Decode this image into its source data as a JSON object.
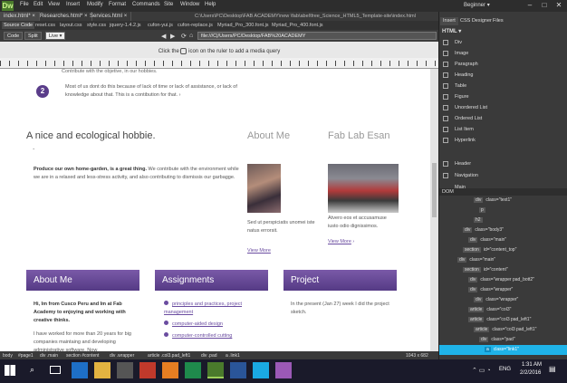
{
  "app": {
    "logo": "Dw",
    "menus": [
      "File",
      "Edit",
      "View",
      "Insert",
      "Modify",
      "Format",
      "Commands",
      "Site",
      "Window",
      "Help"
    ],
    "workspace": "Beginner",
    "path": "C:\\Users\\PC\\Desktop\\FAB ACADEMY\\new \\fab\\abel\\free_Science_HTML5_Template-site\\index.html"
  },
  "tabs": [
    "index.html*",
    "Researches.html*",
    "Services.html"
  ],
  "related_files": [
    "Source Code",
    "reset.css",
    "layout.css",
    "style.css",
    "jquery-1.4.2.js",
    "cufon-yui.js",
    "cufon-replace.js",
    "Myriad_Pro_300.font.js",
    "Myriad_Pro_400.font.js"
  ],
  "doc_toolbar": {
    "code": "Code",
    "split": "Split",
    "live": "Live",
    "url": "file:///C|/Users/PC/Desktop/FAB%20ACADEMY"
  },
  "media_query_hint": {
    "before": "Click the",
    "after": "icon on the ruler to add a media query"
  },
  "page": {
    "item2_num": "2",
    "item2_text_top": "Contribute with the objetive, in our hobbies.",
    "item2_text": "Most of us dont do this because of lack of time or lack of assistance, or lack of knowledge about that. This is a contibution for that.",
    "hobby_title": "A nice and ecological hobbie.",
    "hobby_dot": ".",
    "hobby_strong": "Produce our own home-garden, is a great thing.",
    "hobby_text": "We contribute with the environment while we are in a relaxed and less-stress activity, and also contributing to dismissis our garbagge.",
    "about_title": "About Me",
    "about_text": "Sed ut perspiciatis unomei iste natus errorsit.",
    "about_more": "View More",
    "lab_title": "Fab Lab Esan",
    "lab_text": "Atvero eos et accusamuse iusto odio dignissimos.",
    "lab_more": "View More",
    "box1_title": "About Me",
    "box1_bold": "Hi, Im from Cusco Peru and Im at Fab Academy to enjoying and working with creative thinks.",
    "box1_text": "I have worked for more than 20 years for big companies maintaing and developing administrative software. Now",
    "box2_title": "Assignments",
    "box2_links": [
      "principles and practices, project management",
      "computer-aided design",
      "computer-controlled cutting"
    ],
    "box3_title": "Project",
    "box3_text": "In the present (Jan 27) week I did the project sketch."
  },
  "status": {
    "crumbs": [
      "body",
      "#page1",
      "div .main",
      "section #content",
      "div .wrapper",
      "article .col3.pad_left1",
      "div .pad",
      "a .link1"
    ],
    "size": "1043 x 682"
  },
  "panel": {
    "tabs": [
      "Insert",
      "CSS Designer",
      "Files"
    ],
    "category": "HTML",
    "items": [
      "Div",
      "Image",
      "Paragraph",
      "Heading",
      "Table",
      "Figure",
      "Unordered List",
      "Ordered List",
      "List Item",
      "Hyperlink"
    ],
    "items2": [
      "Header",
      "Navigation",
      "Main"
    ],
    "dom_label": "DOM",
    "dom": [
      {
        "tag": "div",
        "attr": "class=\"text1\""
      },
      {
        "tag": "p",
        "attr": ""
      },
      {
        "tag": "h2",
        "attr": ""
      },
      {
        "tag": "div",
        "attr": "class=\"body3\""
      },
      {
        "tag": "div",
        "attr": "class=\"main\""
      },
      {
        "tag": "section",
        "attr": "id=\"content_top\""
      },
      {
        "tag": "div",
        "attr": "class=\"main\""
      },
      {
        "tag": "section",
        "attr": "id=\"content\""
      },
      {
        "tag": "div",
        "attr": "class=\"wrapper pad_bott2\""
      },
      {
        "tag": "div",
        "attr": "class=\"wrapper\""
      },
      {
        "tag": "div",
        "attr": "class=\"wrapper\""
      },
      {
        "tag": "article",
        "attr": "class=\"col3\""
      },
      {
        "tag": "article",
        "attr": "class=\"col3 pad_left1\""
      },
      {
        "tag": "article",
        "attr": "class=\"col3 pad_left1\""
      },
      {
        "tag": "div",
        "attr": "class=\"pad\""
      },
      {
        "tag": "a",
        "attr": "class=\"link1\""
      }
    ]
  },
  "taskbar": {
    "lang": "ENG",
    "time": "1:31 AM",
    "date": "2/2/2016"
  },
  "colors": {
    "accent": "#6a4ca0",
    "selected": "#1fb3e8",
    "dw_green": "#4a7a2c"
  }
}
